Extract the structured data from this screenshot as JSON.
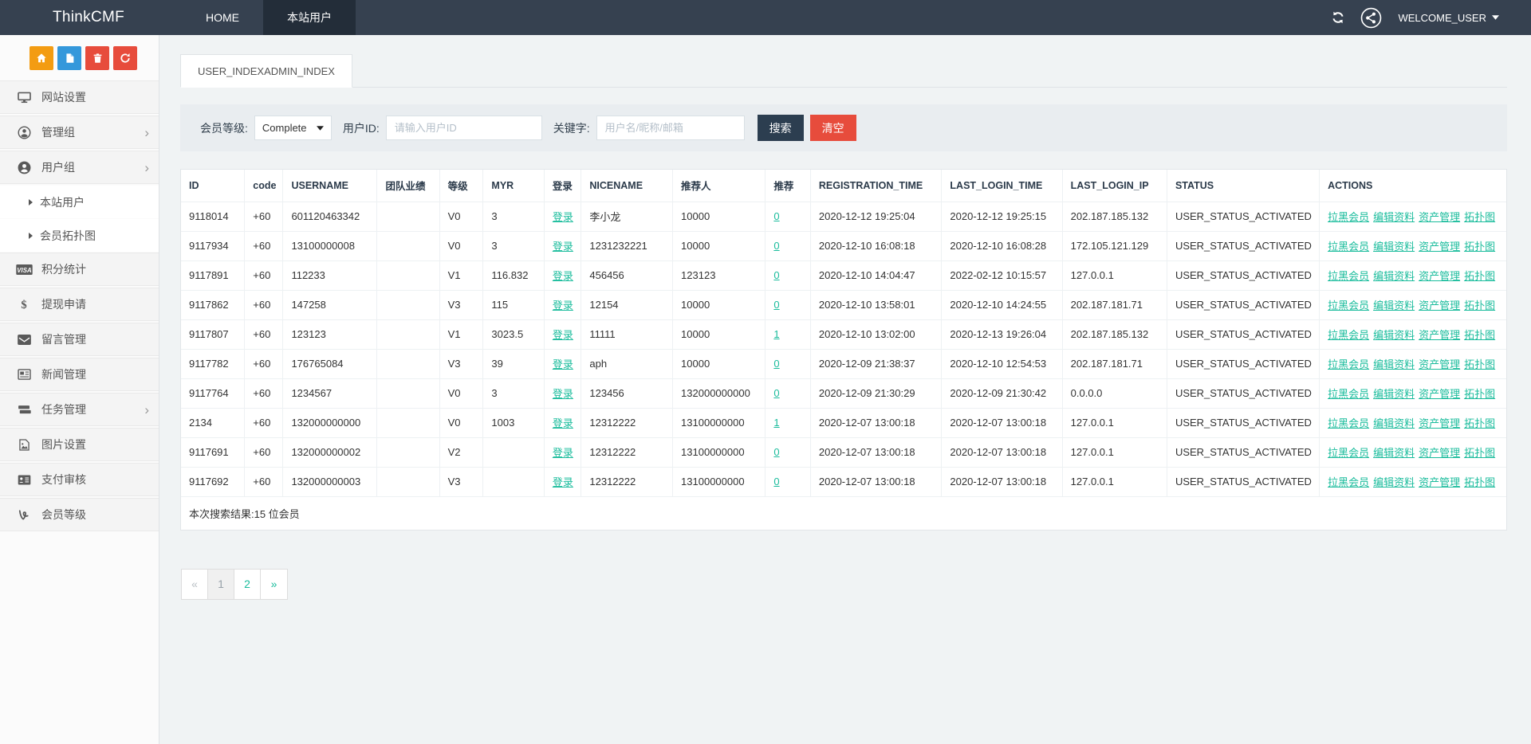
{
  "colors": {
    "navbar_bg": "#364150",
    "navbar_active_bg": "#232d39",
    "accent_green": "#1abc9c",
    "search_btn": "#2c3e50",
    "clear_btn": "#e74c3c",
    "quick_orange": "#f39c12",
    "quick_blue": "#3498db",
    "quick_red": "#e74c3c"
  },
  "navbar": {
    "brand": "ThinkCMF",
    "items": [
      {
        "name": "home-tab",
        "label": "HOME",
        "active": false
      },
      {
        "name": "site-users-tab",
        "label": "本站用户",
        "active": true
      }
    ],
    "refresh_icon": "refresh-icon",
    "avatar_icon": "avatar-icon",
    "welcome": "WELCOME_USER"
  },
  "sidebar": {
    "quick_buttons": [
      {
        "name": "home-button",
        "icon": "home-icon",
        "color": "#f39c12"
      },
      {
        "name": "file-button",
        "icon": "file-icon",
        "color": "#3498db"
      },
      {
        "name": "trash-button",
        "icon": "trash-icon",
        "color": "#e74c3c"
      },
      {
        "name": "recycle-button",
        "icon": "recycle-icon",
        "color": "#e74c3c"
      }
    ],
    "items": [
      {
        "name": "site-settings",
        "label": "网站设置",
        "icon": "monitor-icon",
        "chevron": false
      },
      {
        "name": "admin-group",
        "label": "管理组",
        "icon": "admin-group-icon",
        "chevron": true
      },
      {
        "name": "user-group",
        "label": "用户组",
        "icon": "user-group-icon",
        "chevron": true,
        "submenu": [
          {
            "name": "site-users",
            "label": "本站用户"
          },
          {
            "name": "member-topology",
            "label": "会员拓扑图"
          }
        ]
      },
      {
        "name": "points-statistics",
        "label": "积分统计",
        "icon": "visa-icon",
        "chevron": false
      },
      {
        "name": "withdrawal-request",
        "label": "提现申请",
        "icon": "dollar-icon",
        "chevron": false
      },
      {
        "name": "message-management",
        "label": "留言管理",
        "icon": "envelope-icon",
        "chevron": false
      },
      {
        "name": "news-management",
        "label": "新闻管理",
        "icon": "news-icon",
        "chevron": false
      },
      {
        "name": "task-management",
        "label": "任务管理",
        "icon": "tasks-icon",
        "chevron": true
      },
      {
        "name": "image-settings",
        "label": "图片设置",
        "icon": "image-icon",
        "chevron": false
      },
      {
        "name": "payment-review",
        "label": "支付审核",
        "icon": "payment-icon",
        "chevron": false
      },
      {
        "name": "member-level",
        "label": "会员等级",
        "icon": "level-icon",
        "chevron": false
      }
    ]
  },
  "content": {
    "tab": "USER_INDEXADMIN_INDEX",
    "filter": {
      "level_label": "会员等级:",
      "level_value": "Complete",
      "userid_label": "用户ID:",
      "userid_placeholder": "请输入用户ID",
      "keyword_label": "关键字:",
      "keyword_placeholder": "用户名/昵称/邮箱",
      "search_label": "搜索",
      "clear_label": "清空"
    },
    "table": {
      "columns": [
        "ID",
        "code",
        "USERNAME",
        "团队业绩",
        "等级",
        "MYR",
        "登录",
        "NICENAME",
        "推荐人",
        "推荐",
        "REGISTRATION_TIME",
        "LAST_LOGIN_TIME",
        "LAST_LOGIN_IP",
        "STATUS",
        "ACTIONS"
      ],
      "login_label": "登录",
      "actions": [
        {
          "name": "blacklist-member-link",
          "label": "拉黑会员"
        },
        {
          "name": "edit-profile-link",
          "label": "编辑资料"
        },
        {
          "name": "asset-management-link",
          "label": "资产管理"
        },
        {
          "name": "topology-link",
          "label": "拓扑图"
        }
      ],
      "rows": [
        {
          "id": "9118014",
          "code": "+60",
          "username": "601120463342",
          "team": "",
          "level": "V0",
          "myr": "3",
          "nicename": "李小龙",
          "referrer": "10000",
          "ref": "0",
          "reg_time": "2020-12-12 19:25:04",
          "last_login_time": "2020-12-12 19:25:15",
          "last_login_ip": "202.187.185.132",
          "status": "USER_STATUS_ACTIVATED"
        },
        {
          "id": "9117934",
          "code": "+60",
          "username": "13100000008",
          "team": "",
          "level": "V0",
          "myr": "3",
          "nicename": "1231232221",
          "referrer": "10000",
          "ref": "0",
          "reg_time": "2020-12-10 16:08:18",
          "last_login_time": "2020-12-10 16:08:28",
          "last_login_ip": "172.105.121.129",
          "status": "USER_STATUS_ACTIVATED"
        },
        {
          "id": "9117891",
          "code": "+60",
          "username": "112233",
          "team": "",
          "level": "V1",
          "myr": "116.832",
          "nicename": "456456",
          "referrer": "123123",
          "ref": "0",
          "reg_time": "2020-12-10 14:04:47",
          "last_login_time": "2022-02-12 10:15:57",
          "last_login_ip": "127.0.0.1",
          "status": "USER_STATUS_ACTIVATED"
        },
        {
          "id": "9117862",
          "code": "+60",
          "username": "147258",
          "team": "",
          "level": "V3",
          "myr": "115",
          "nicename": "12154",
          "referrer": "10000",
          "ref": "0",
          "reg_time": "2020-12-10 13:58:01",
          "last_login_time": "2020-12-10 14:24:55",
          "last_login_ip": "202.187.181.71",
          "status": "USER_STATUS_ACTIVATED"
        },
        {
          "id": "9117807",
          "code": "+60",
          "username": "123123",
          "team": "",
          "level": "V1",
          "myr": "3023.5",
          "nicename": "11111",
          "referrer": "10000",
          "ref": "1",
          "reg_time": "2020-12-10 13:02:00",
          "last_login_time": "2020-12-13 19:26:04",
          "last_login_ip": "202.187.185.132",
          "status": "USER_STATUS_ACTIVATED"
        },
        {
          "id": "9117782",
          "code": "+60",
          "username": "176765084",
          "team": "",
          "level": "V3",
          "myr": "39",
          "nicename": "aph",
          "referrer": "10000",
          "ref": "0",
          "reg_time": "2020-12-09 21:38:37",
          "last_login_time": "2020-12-10 12:54:53",
          "last_login_ip": "202.187.181.71",
          "status": "USER_STATUS_ACTIVATED"
        },
        {
          "id": "9117764",
          "code": "+60",
          "username": "1234567",
          "team": "",
          "level": "V0",
          "myr": "3",
          "nicename": "123456",
          "referrer": "132000000000",
          "ref": "0",
          "reg_time": "2020-12-09 21:30:29",
          "last_login_time": "2020-12-09 21:30:42",
          "last_login_ip": "0.0.0.0",
          "status": "USER_STATUS_ACTIVATED"
        },
        {
          "id": "2134",
          "code": "+60",
          "username": "132000000000",
          "team": "",
          "level": "V0",
          "myr": "1003",
          "nicename": "12312222",
          "referrer": "13100000000",
          "ref": "1",
          "reg_time": "2020-12-07 13:00:18",
          "last_login_time": "2020-12-07 13:00:18",
          "last_login_ip": "127.0.0.1",
          "status": "USER_STATUS_ACTIVATED"
        },
        {
          "id": "9117691",
          "code": "+60",
          "username": "132000000002",
          "team": "",
          "level": "V2",
          "myr": "",
          "nicename": "12312222",
          "referrer": "13100000000",
          "ref": "0",
          "reg_time": "2020-12-07 13:00:18",
          "last_login_time": "2020-12-07 13:00:18",
          "last_login_ip": "127.0.0.1",
          "status": "USER_STATUS_ACTIVATED"
        },
        {
          "id": "9117692",
          "code": "+60",
          "username": "132000000003",
          "team": "",
          "level": "V3",
          "myr": "",
          "nicename": "12312222",
          "referrer": "13100000000",
          "ref": "0",
          "reg_time": "2020-12-07 13:00:18",
          "last_login_time": "2020-12-07 13:00:18",
          "last_login_ip": "127.0.0.1",
          "status": "USER_STATUS_ACTIVATED"
        }
      ],
      "summary": "本次搜索结果:15 位会员"
    },
    "pagination": [
      {
        "name": "page-prev",
        "label": "«",
        "state": "disabled"
      },
      {
        "name": "page-1",
        "label": "1",
        "state": "active"
      },
      {
        "name": "page-2",
        "label": "2",
        "state": "link"
      },
      {
        "name": "page-next",
        "label": "»",
        "state": "link"
      }
    ]
  }
}
